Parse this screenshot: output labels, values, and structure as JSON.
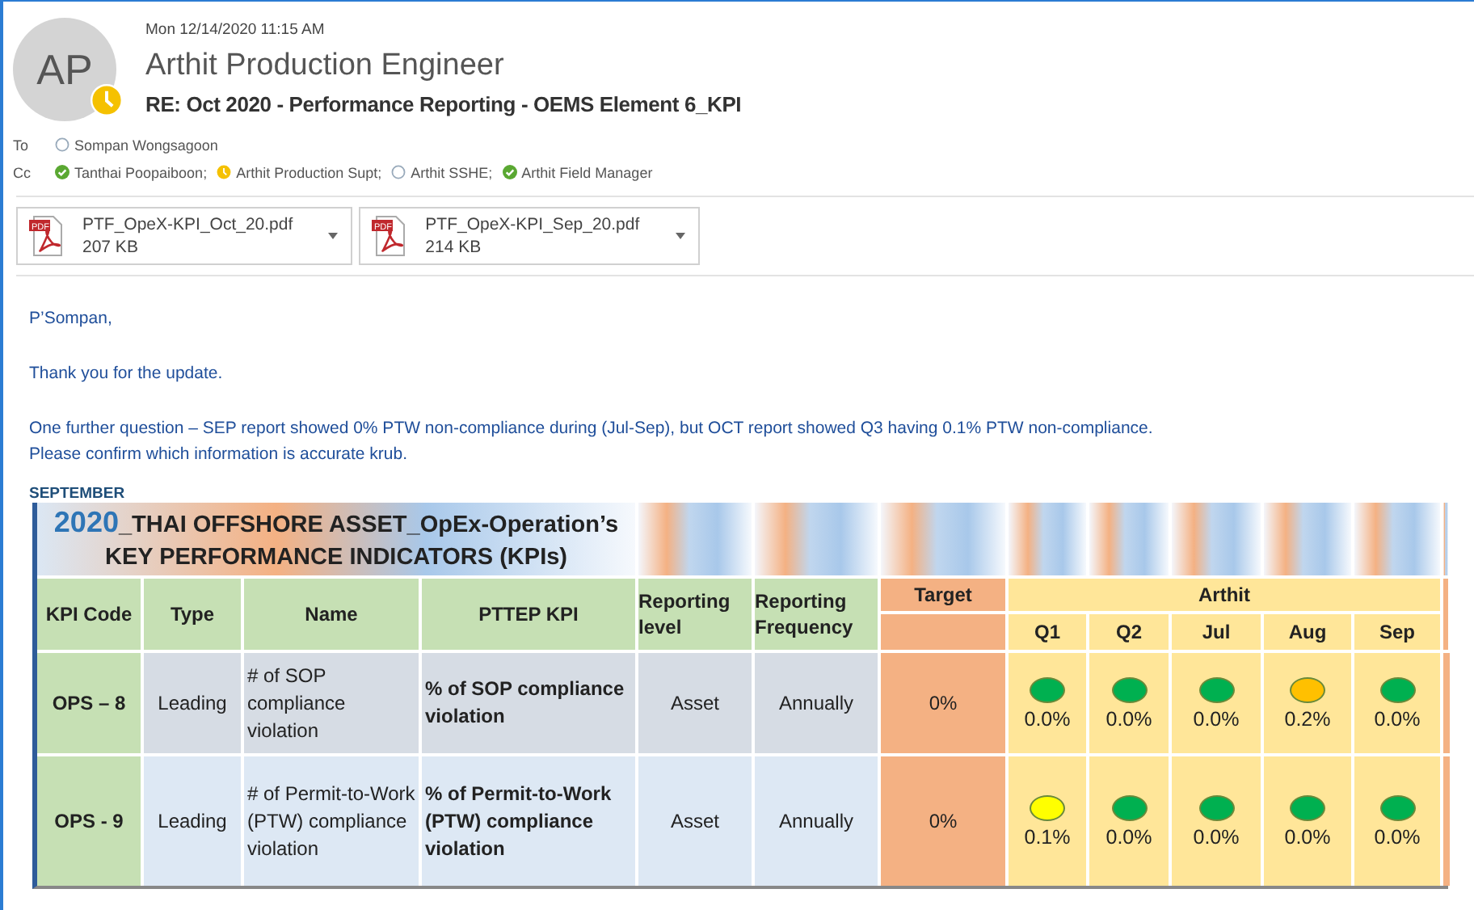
{
  "header": {
    "avatar_initials": "AP",
    "avatar_badge": {
      "kind": "away"
    },
    "date": "Mon 12/14/2020 11:15 AM",
    "sender": "Arthit Production Engineer",
    "subject": "RE: Oct 2020 - Performance Reporting - OEMS Element 6_KPI",
    "to_label": "To",
    "to": [
      {
        "name": "Sompan Wongsagoon",
        "kind": "offline"
      }
    ],
    "cc_label": "Cc",
    "cc": [
      {
        "name": "Tanthai Poopaiboon;",
        "kind": "available"
      },
      {
        "name": "Arthit Production Supt;",
        "kind": "away"
      },
      {
        "name": "Arthit SSHE;",
        "kind": "offline"
      },
      {
        "name": "Arthit Field Manager",
        "kind": "available"
      }
    ]
  },
  "attachments": [
    {
      "name": "PTF_OpeX-KPI_Oct_20.pdf",
      "size": "207 KB",
      "icon_label": "PDF"
    },
    {
      "name": "PTF_OpeX-KPI_Sep_20.pdf",
      "size": "214 KB",
      "icon_label": "PDF"
    }
  ],
  "body": [
    "P’Sompan,",
    "Thank you for the update.",
    "One further question –  SEP report showed 0% PTW non-compliance during (Jul-Sep), but OCT report showed Q3 having 0.1% PTW non-compliance.\nPlease confirm which information is accurate krub."
  ],
  "section_label": "SEPTEMBER",
  "kpi_table": {
    "title_year": "2020",
    "title_rest": "_THAI OFFSHORE ASSET_OpEx-Operation’s",
    "title_line2": "KEY PERFORMANCE INDICATORS (KPIs)",
    "columns": [
      "KPI Code",
      "Type",
      "Name",
      "PTTEP KPI",
      "Reporting level",
      "Reporting Frequency"
    ],
    "target_label": "Target",
    "group_label": "Arthit",
    "periods": [
      "Q1",
      "Q2",
      "Jul",
      "Aug",
      "Sep"
    ],
    "rows": [
      {
        "code": "OPS – 8",
        "type": "Leading",
        "name": "# of SOP compliance violation",
        "pttep_kpi": "% of SOP compliance violation",
        "level": "Asset",
        "frequency": "Annually",
        "target": "0%",
        "results": [
          {
            "value": "0.0%",
            "color": "#00b050"
          },
          {
            "value": "0.0%",
            "color": "#00b050"
          },
          {
            "value": "0.0%",
            "color": "#00b050"
          },
          {
            "value": "0.2%",
            "color": "#ffc000"
          },
          {
            "value": "0.0%",
            "color": "#00b050"
          }
        ]
      },
      {
        "code": "OPS - 9",
        "type": "Leading",
        "name": "# of Permit-to-Work (PTW) compliance violation",
        "pttep_kpi": "% of Permit-to-Work (PTW) compliance violation",
        "level": "Asset",
        "frequency": "Annually",
        "target": "0%",
        "results": [
          {
            "value": "0.1%",
            "color": "#ffff00"
          },
          {
            "value": "0.0%",
            "color": "#00b050"
          },
          {
            "value": "0.0%",
            "color": "#00b050"
          },
          {
            "value": "0.0%",
            "color": "#00b050"
          },
          {
            "value": "0.0%",
            "color": "#00b050"
          }
        ]
      }
    ]
  }
}
